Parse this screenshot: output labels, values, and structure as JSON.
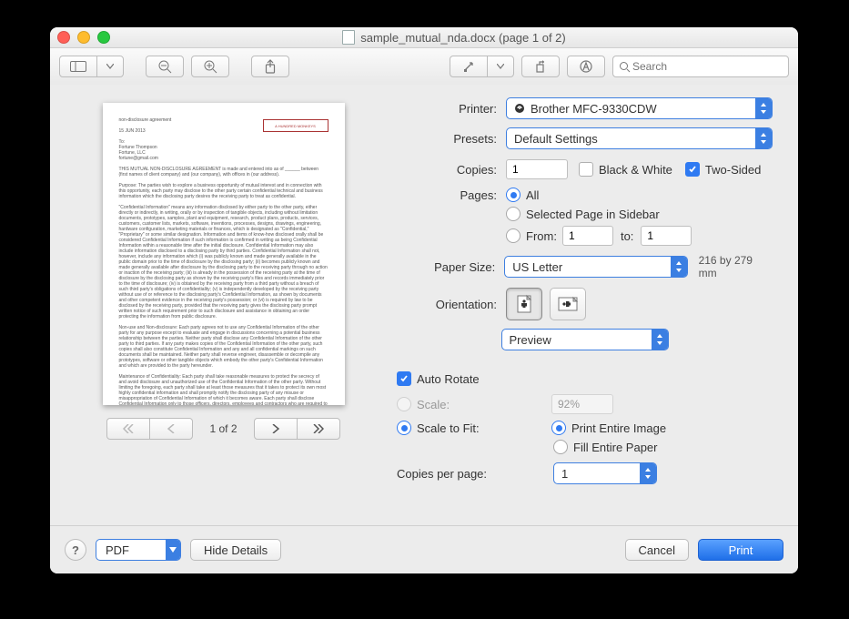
{
  "window": {
    "title": "sample_mutual_nda.docx (page 1 of 2)"
  },
  "toolbar": {
    "search_placeholder": "Search"
  },
  "preview": {
    "logo_text": "A HUNDRED MONKEYS",
    "doc_text": "non-disclosure agreement\n\n15 JUN 2013\n\nTo:\nFortune Thompson\nFortune, LLC\nfortune@gmail.com\n\nTHIS MUTUAL NON-DISCLOSURE AGREEMENT is made and entered into as of ______ between (first names of client company) and (our company), with offices in (our address).\n\nPurpose: The parties wish to explore a business opportunity of mutual interest and in connection with this opportunity, each party may disclose to the other party certain confidential technical and business information which the disclosing party desires the receiving party to treat as confidential.\n\n\"Confidential Information\" means any information disclosed by either party to the other party, either directly or indirectly, in writing, orally or by inspection of tangible objects, including without limitation documents, prototypes, samples, plant and equipment, research, product plans, products, services, customers, customer lists, markets, software, inventions, processes, designs, drawings, engineering, hardware configuration, marketing materials or finances, which is designated as \"Confidential,\" \"Proprietary\" or some similar designation. Information and items of know-how disclosed orally shall be considered Confidential Information if such information is confirmed in writing as being Confidential Information within a reasonable time after the initial disclosure. Confidential Information may also include information disclosed to a disclosing party by third parties. Confidential Information shall not, however, include any information which (i) was publicly known and made generally available in the public domain prior to the time of disclosure by the disclosing party; (ii) becomes publicly known and made generally available after disclosure by the disclosing party to the receiving party through no action or inaction of the receiving party; (iii) is already in the possession of the receiving party at the time of disclosure by the disclosing party as shown by the receiving party's files and records immediately prior to the time of disclosure; (iv) is obtained by the receiving party from a third party without a breach of such third party's obligations of confidentiality; (v) is independently developed by the receiving party without use of or reference to the disclosing party's Confidential Information, as shown by documents and other competent evidence in the receiving party's possession; or (vi) is required by law to be disclosed by the receiving party, provided that the receiving party gives the disclosing party prompt written notice of such requirement prior to such disclosure and assistance in obtaining an order protecting the information from public disclosure.\n\nNon-use and Non-disclosure: Each party agrees not to use any Confidential Information of the other party for any purpose except to evaluate and engage in discussions concerning a potential business relationship between the parties. Neither party shall disclose any Confidential Information of the other party to third parties. If any party makes copies of the Confidential Information of the other party, such copies shall also constitute Confidential Information and any and all confidential markings on such documents shall be maintained. Neither party shall reverse engineer, disassemble or decompile any prototypes, software or other tangible objects which embody the other party's Confidential Information and which are provided to the party hereunder.\n\nMaintenance of Confidentiality: Each party shall take reasonable measures to protect the secrecy of and avoid disclosure and unauthorized use of the Confidential Information of the other party. Without limiting the foregoing, each party shall take at least those measures that it takes to protect its own most highly confidential information and shall promptly notify the disclosing party of any misuse or misappropriation of Confidential Information of which it becomes aware. Each party shall disclose Confidential Information only to those officers, directors, employees and contractors who are required to have the information in order to evaluate or engage in discussions concerning the contemplated business relationship, and such party shall remain responsible for compliance with the terms of this Agreement by its officers, directors, employees and contractors.\n\nNo Obligation: Nothing herein shall obligate either party to proceed with any transaction between them, and each",
    "pager_label": "1 of 2"
  },
  "labels": {
    "printer": "Printer:",
    "presets": "Presets:",
    "copies": "Copies:",
    "bw": "Black & White",
    "two_sided": "Two-Sided",
    "pages": "Pages:",
    "all": "All",
    "sel_in_sidebar": "Selected Page in Sidebar",
    "from": "From:",
    "to": "to:",
    "paper_size": "Paper Size:",
    "orientation": "Orientation:",
    "copies_per_page": "Copies per page:",
    "auto_rotate": "Auto Rotate",
    "scale": "Scale:",
    "scale_to_fit": "Scale to Fit:",
    "print_entire": "Print Entire Image",
    "fill_paper": "Fill Entire Paper"
  },
  "values": {
    "printer": "Brother MFC-9330CDW",
    "presets": "Default Settings",
    "copies": "1",
    "two_sided_checked": true,
    "pages_from": "1",
    "pages_to": "1",
    "paper_size": "US Letter",
    "paper_dim": "216 by 279 mm",
    "module": "Preview",
    "scale_pct": "92%",
    "copies_per_page": "1"
  },
  "footer": {
    "pdf": "PDF",
    "hide_details": "Hide Details",
    "cancel": "Cancel",
    "print": "Print"
  }
}
